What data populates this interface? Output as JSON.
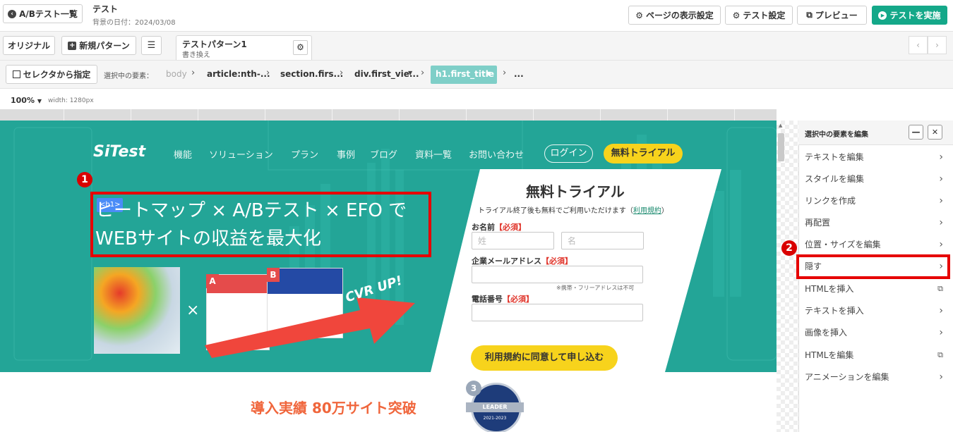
{
  "topbar": {
    "back_label": "A/Bテスト一覧",
    "test_name": "テスト",
    "bg_date": "背景の日付：2024/03/08",
    "page_display_settings": "ページの表示設定",
    "test_settings": "テスト設定",
    "preview": "プレビュー",
    "run_test": "テストを実施"
  },
  "patterns": {
    "original": "オリジナル",
    "new_pattern": "新規パターン",
    "active_tab_title": "テストパターン1",
    "active_tab_sub": "書き換え"
  },
  "selector": {
    "button": "セレクタから指定",
    "label": "選択中の要素：",
    "crumbs": [
      "body",
      "article:nth-...",
      "section.firs...",
      "div.first_vie...",
      "h1.first_title",
      "..."
    ]
  },
  "zoom": {
    "value": "100%",
    "width": "width: 1280px"
  },
  "site": {
    "logo": "SiTest",
    "nav": [
      "機能",
      "ソリューション",
      "プラン",
      "事例",
      "ブログ",
      "資料一覧",
      "お問い合わせ"
    ],
    "login": "ログイン",
    "trial_button": "無料トライアル",
    "h1_tag": "<h1>",
    "title_line1": "ヒートマップ × A/Bテスト × EFO で",
    "title_line2": "WEBサイトの収益を最大化",
    "cvr": "CVR UP!",
    "label_a": "A",
    "label_b": "B",
    "times": "×",
    "form": {
      "title": "無料トライアル",
      "subtitle": "トライアル終了後も無料でご利用いただけます（",
      "subtitle_link": "利用規約",
      "subtitle_end": "）",
      "name_label": "お名前",
      "required": "【必須】",
      "last_name_ph": "姓",
      "first_name_ph": "名",
      "email_label": "企業メールアドレス",
      "email_note": "※携帯・フリーアドレスは不可",
      "phone_label": "電話番号",
      "submit": "利用規約に同意して申し込む"
    },
    "results": "導入実績 80万サイト突破",
    "badge_num": "3",
    "badge_text": "LEADER",
    "badge_year": "2021-2023"
  },
  "panel": {
    "title": "選択中の要素を編集",
    "items": [
      "テキストを編集",
      "スタイルを編集",
      "リンクを作成",
      "再配置",
      "位置・サイズを編集",
      "隠す",
      "HTMLを挿入",
      "テキストを挿入",
      "画像を挿入",
      "HTMLを編集",
      "アニメーションを編集"
    ]
  },
  "markers": {
    "one": "1",
    "two": "2"
  },
  "colors": {
    "accent": "#14a889",
    "hero": "#23a597",
    "highlight": "#e60000",
    "trial_yellow": "#f7d31c"
  }
}
